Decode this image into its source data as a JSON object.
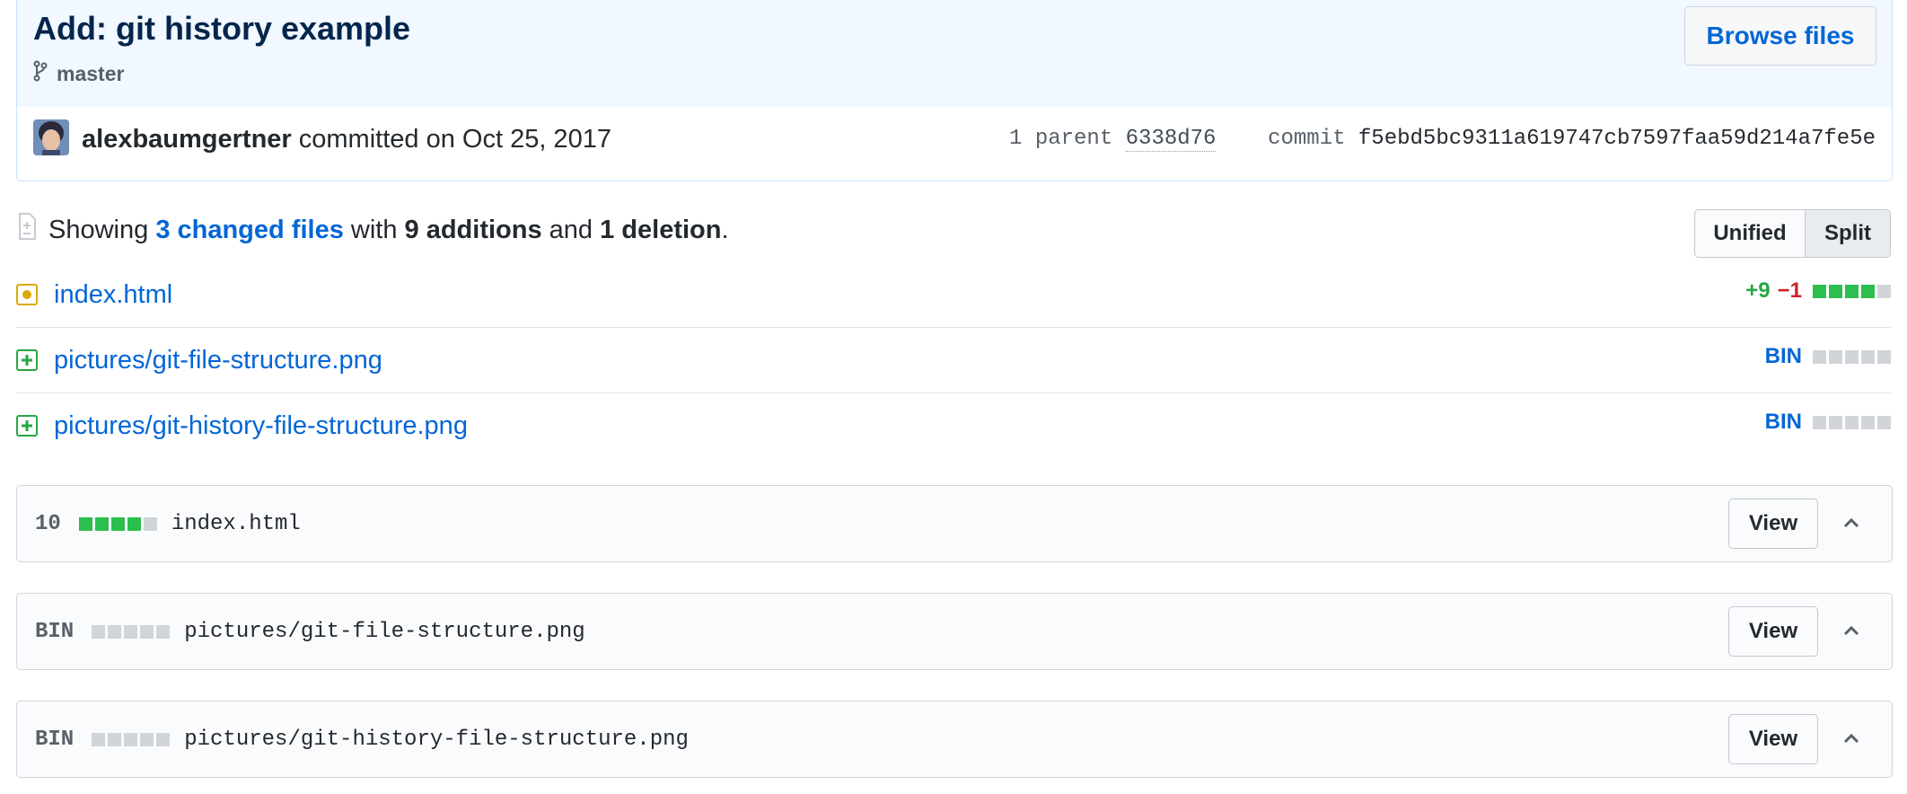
{
  "commit": {
    "title": "Add: git history example",
    "branch": "master",
    "browse_files_label": "Browse files",
    "author": "alexbaumgertner",
    "committed_text": "committed on Oct 25, 2017",
    "parent_label": "1 parent",
    "parent_sha": "6338d76",
    "commit_label": "commit",
    "sha": "f5ebd5bc9311a619747cb7597faa59d214a7fe5e"
  },
  "toc": {
    "showing": "Showing",
    "changed_files": "3 changed files",
    "with": "with",
    "additions": "9 additions",
    "and": "and",
    "deletions": "1 deletion",
    "period": ".",
    "unified_label": "Unified",
    "split_label": "Split",
    "files": [
      {
        "name": "index.html",
        "status": "modified",
        "additions": "+9",
        "deletions": "−1"
      },
      {
        "name": "pictures/git-file-structure.png",
        "status": "added",
        "bin": "BIN"
      },
      {
        "name": "pictures/git-history-file-structure.png",
        "status": "added",
        "bin": "BIN"
      }
    ]
  },
  "diff_files": [
    {
      "count": "10",
      "path": "index.html",
      "view_label": "View"
    },
    {
      "count": "BIN",
      "path": "pictures/git-file-structure.png",
      "view_label": "View"
    },
    {
      "count": "BIN",
      "path": "pictures/git-history-file-structure.png",
      "view_label": "View"
    }
  ],
  "colors": {
    "link": "#0366d6",
    "addition": "#28a745",
    "deletion": "#cb2431",
    "modified_icon": "#dbab09",
    "header_bg": "#f1f8ff"
  }
}
